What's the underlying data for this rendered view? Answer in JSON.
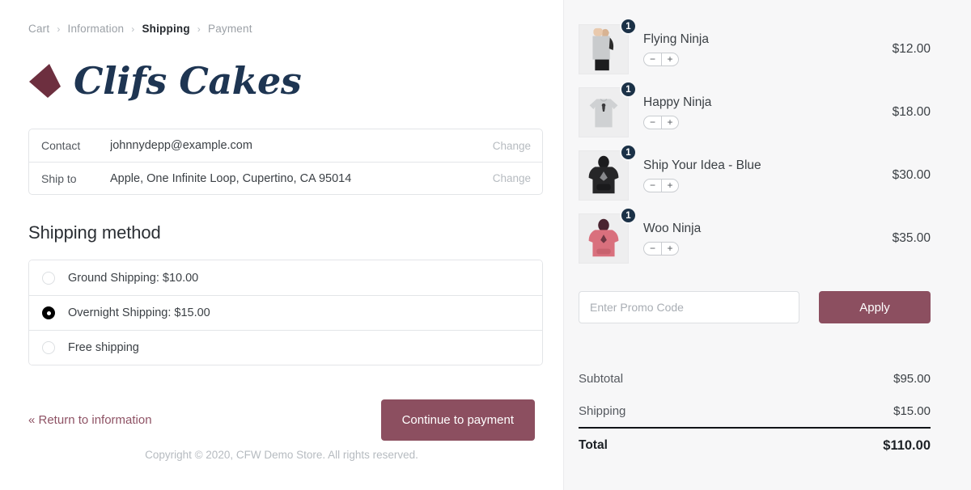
{
  "breadcrumb": {
    "separator": "›",
    "items": [
      {
        "label": "Cart",
        "active": false
      },
      {
        "label": "Information",
        "active": false
      },
      {
        "label": "Shipping",
        "active": true
      },
      {
        "label": "Payment",
        "active": false
      }
    ]
  },
  "brand": {
    "name": "Clifs Cakes",
    "mark_color": "#6d2f3f",
    "text_color": "#1e3552"
  },
  "review": {
    "rows": [
      {
        "label": "Contact",
        "value": "johnnydepp@example.com",
        "change_label": "Change"
      },
      {
        "label": "Ship to",
        "value": "Apple, One Infinite Loop, Cupertino, CA 95014",
        "change_label": "Change"
      }
    ]
  },
  "shipping": {
    "title": "Shipping method",
    "options": [
      {
        "label": "Ground Shipping: $10.00",
        "selected": false
      },
      {
        "label": "Overnight Shipping: $15.00",
        "selected": true
      },
      {
        "label": "Free shipping",
        "selected": false
      }
    ]
  },
  "actions": {
    "return_label": "« Return to information",
    "continue_label": "Continue to payment",
    "accent_color": "#8c4f60"
  },
  "footer": {
    "copyright": "Copyright © 2020, CFW Demo Store. All rights reserved."
  },
  "cart": {
    "items": [
      {
        "name": "Flying Ninja",
        "price": "$12.00",
        "qty": "1",
        "minus": "−",
        "plus": "+",
        "thumb": "person-holding-gray-tshirt"
      },
      {
        "name": "Happy Ninja",
        "price": "$18.00",
        "qty": "1",
        "minus": "−",
        "plus": "+",
        "thumb": "gray-tshirt"
      },
      {
        "name": "Ship Your Idea - Blue",
        "price": "$30.00",
        "qty": "1",
        "minus": "−",
        "plus": "+",
        "thumb": "black-hoodie"
      },
      {
        "name": "Woo Ninja",
        "price": "$35.00",
        "qty": "1",
        "minus": "−",
        "plus": "+",
        "thumb": "pink-hoodie"
      }
    ],
    "badge_color": "#1b3147"
  },
  "promo": {
    "placeholder": "Enter Promo Code",
    "value": "",
    "apply_label": "Apply"
  },
  "totals": {
    "rows": [
      {
        "label": "Subtotal",
        "amount": "$95.00"
      },
      {
        "label": "Shipping",
        "amount": "$15.00"
      }
    ],
    "grand": {
      "label": "Total",
      "amount": "$110.00"
    }
  }
}
